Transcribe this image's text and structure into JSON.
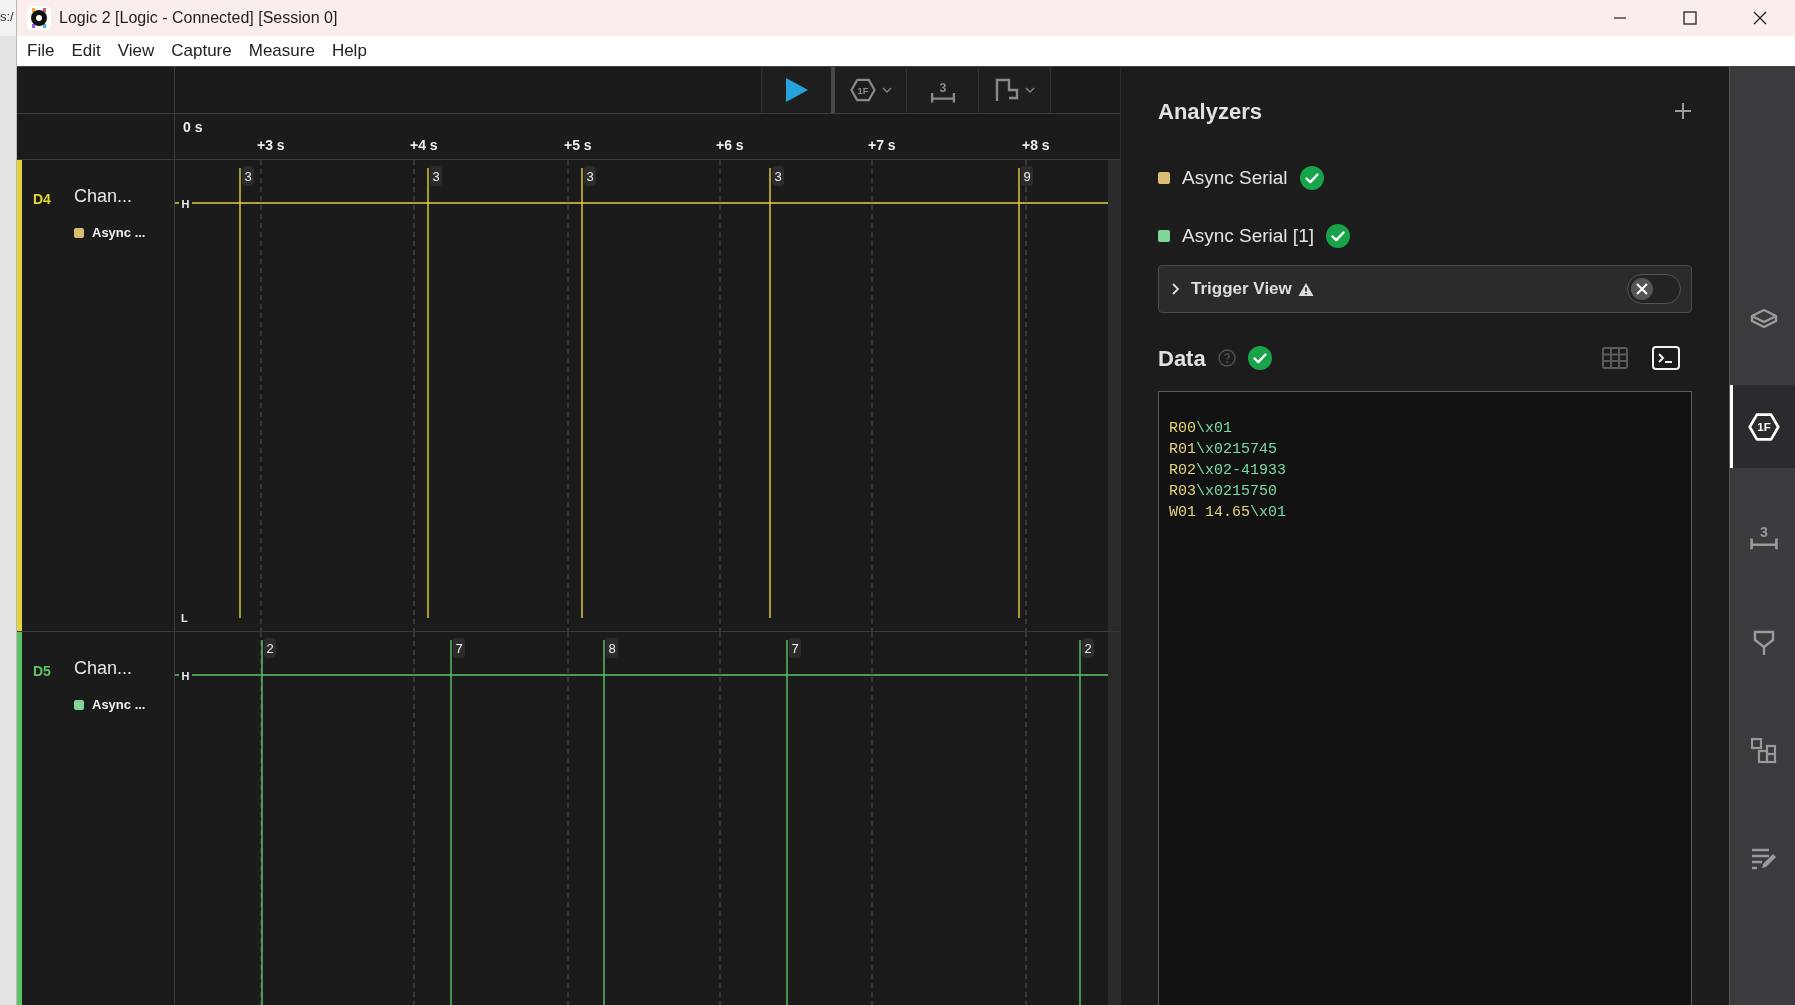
{
  "background_window": {
    "text": "s:/"
  },
  "window": {
    "title": "Logic 2 [Logic - Connected] [Session 0]"
  },
  "menu": [
    "File",
    "Edit",
    "View",
    "Capture",
    "Measure",
    "Help"
  ],
  "toolbar": [
    {
      "kind": "play"
    },
    {
      "kind": "analyzer",
      "label": "1F"
    },
    {
      "kind": "measure",
      "label": "3"
    },
    {
      "kind": "annotation"
    }
  ],
  "timeline": {
    "ticks": [
      "0 s",
      "+3 s",
      "+4 s",
      "+5 s",
      "+6 s",
      "+7 s",
      "+8 s"
    ]
  },
  "channels": [
    {
      "id": "D4",
      "name": "Chan...",
      "color": "#e3d23c",
      "analyzer": {
        "name": "Async ...",
        "color": "#d8bd72"
      },
      "high_label": "H",
      "low_label": "L",
      "markers": [
        "3",
        "3",
        "3",
        "3",
        "9"
      ]
    },
    {
      "id": "D5",
      "name": "Chan...",
      "color": "#5cc466",
      "analyzer": {
        "name": "Async ...",
        "color": "#7fd59a"
      },
      "high_label": "H",
      "markers": [
        "2",
        "7",
        "8",
        "7",
        "2"
      ]
    }
  ],
  "analyzers": {
    "title": "Analyzers",
    "items": [
      {
        "name": "Async Serial",
        "color": "#d8bd72",
        "ok": true
      },
      {
        "name": "Async Serial [1]",
        "color": "#7fd59a",
        "ok": true
      }
    ]
  },
  "trigger_view": {
    "label": "Trigger View",
    "expanded": false,
    "on": false
  },
  "data": {
    "title": "Data",
    "ok": true,
    "views": [
      {
        "kind": "table",
        "selected": false
      },
      {
        "kind": "terminal",
        "selected": true
      }
    ],
    "lines": [
      {
        "address": "R00",
        "value": "\\x01"
      },
      {
        "address": "R01",
        "value": "\\x0215745"
      },
      {
        "address": "R02",
        "value": "\\x02-41933"
      },
      {
        "address": "R03",
        "value": "\\x0215750"
      },
      {
        "address": "W01 14.65",
        "value": "\\x01"
      }
    ]
  },
  "sidebar_tabs": [
    {
      "kind": "layers",
      "selected": false
    },
    {
      "kind": "analyzer",
      "label": "1F",
      "selected": true
    },
    {
      "kind": "measure",
      "label": "3",
      "selected": false
    },
    {
      "kind": "trigger",
      "selected": false
    },
    {
      "kind": "extensions",
      "selected": false
    },
    {
      "kind": "notes",
      "selected": false
    }
  ]
}
